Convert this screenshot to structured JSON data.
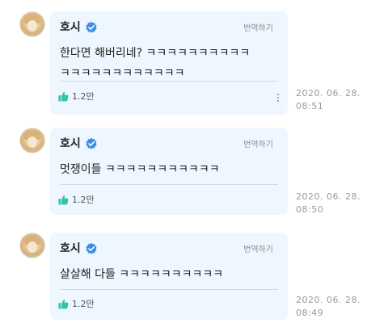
{
  "comments": [
    {
      "author": "호시",
      "translate_label": "번역하기",
      "text": "한다면 해버리네? ㅋㅋㅋㅋㅋㅋㅋㅋㅋㅋ\nㅋㅋㅋㅋㅋㅋㅋㅋㅋㅋㅋㅋ",
      "likes": "1.2만",
      "timestamp": "2020. 06. 28.\n08:51"
    },
    {
      "author": "호시",
      "translate_label": "번역하기",
      "text": "멋쟁이들 ㅋㅋㅋㅋㅋㅋㅋㅋㅋㅋㅋ",
      "likes": "1.2만",
      "timestamp": "2020. 06. 28.\n08:50"
    },
    {
      "author": "호시",
      "translate_label": "번역하기",
      "text": "살살해 다들 ㅋㅋㅋㅋㅋㅋㅋㅋㅋㅋ",
      "likes": "1.2만",
      "timestamp": "2020. 06. 28.\n08:49"
    }
  ],
  "icons": {
    "verified": "verified-badge-icon",
    "like": "thumbs-up-icon",
    "more": "more-vertical-icon"
  },
  "colors": {
    "bubble_bg": "#eef7ff",
    "verified_blue": "#3f8ee6",
    "like_green": "#2ec4a6"
  }
}
